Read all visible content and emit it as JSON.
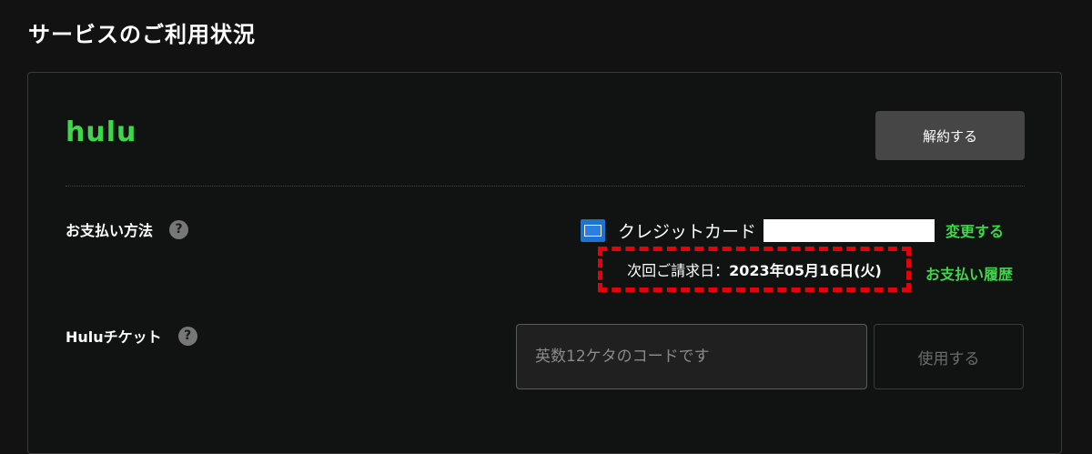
{
  "page": {
    "title": "サービスのご利用状況"
  },
  "service": {
    "logo_text": "hulu",
    "cancel_button": "解約する"
  },
  "payment": {
    "label": "お支払い方法",
    "help": "?",
    "card_icon": "amex-card-icon",
    "card_label": "クレジットカード",
    "change_link": "変更する",
    "next_billing_prefix": "次回ご請求日：",
    "next_billing_date": "2023年05月16日(火)",
    "history_link": "お支払い履歴"
  },
  "ticket": {
    "label": "Huluチケット",
    "help": "?",
    "placeholder": "英数12ケタのコードです",
    "use_button": "使用する"
  },
  "colors": {
    "brand_green": "#3dd84a",
    "highlight_red": "#e8000b",
    "background": "#121212"
  }
}
